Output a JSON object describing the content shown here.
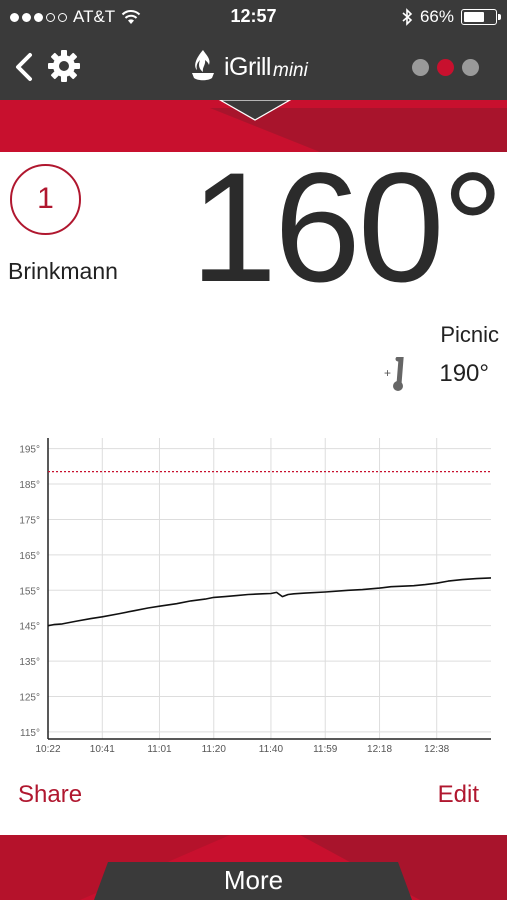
{
  "status_bar": {
    "carrier": "AT&T",
    "time": "12:57",
    "battery_percent": "66%",
    "battery_level": 0.66,
    "signal_bars": 3,
    "signal_total": 5
  },
  "nav": {
    "app_name": "iGrill",
    "app_suffix": "mini",
    "page_count": 3,
    "active_page": 2
  },
  "probe": {
    "number": "1",
    "name": "Brinkmann",
    "current_temp": "160°",
    "preset_name": "Picnic",
    "target_temp": "190°"
  },
  "colors": {
    "accent": "#c8102e",
    "accent_dark": "#b0172f",
    "bar": "#3a3a3a"
  },
  "chart_data": {
    "type": "line",
    "y_ticks": [
      "195°",
      "185°",
      "175°",
      "165°",
      "155°",
      "145°",
      "135°",
      "125°",
      "115°"
    ],
    "ylim": [
      113,
      198
    ],
    "x_ticks": [
      "10:22",
      "10:41",
      "11:01",
      "11:20",
      "11:40",
      "11:59",
      "12:18",
      "12:38"
    ],
    "x_tick_minutes": [
      0,
      19,
      39,
      58,
      78,
      97,
      116,
      136
    ],
    "xlim_minutes": [
      0,
      155
    ],
    "target_line": 188.5,
    "series": [
      {
        "x": [
          0,
          2,
          5,
          10,
          15,
          19,
          25,
          30,
          35,
          39,
          45,
          50,
          55,
          58,
          62,
          66,
          70,
          75,
          78,
          80,
          82,
          84,
          86,
          90,
          97,
          105,
          110,
          116,
          120,
          128,
          132,
          136,
          140,
          145,
          150,
          155
        ],
        "y": [
          145,
          145.3,
          145.5,
          146.3,
          147,
          147.5,
          148.4,
          149.2,
          150,
          150.5,
          151.2,
          152,
          152.5,
          153,
          153.2,
          153.5,
          153.8,
          154,
          154.1,
          154.4,
          153.2,
          153.8,
          154,
          154.2,
          154.5,
          155,
          155.2,
          155.6,
          156,
          156.3,
          156.6,
          157,
          157.6,
          158,
          158.3,
          158.5
        ]
      }
    ],
    "grid": true
  },
  "actions": {
    "share_label": "Share",
    "edit_label": "Edit"
  },
  "footer": {
    "more_label": "More"
  }
}
